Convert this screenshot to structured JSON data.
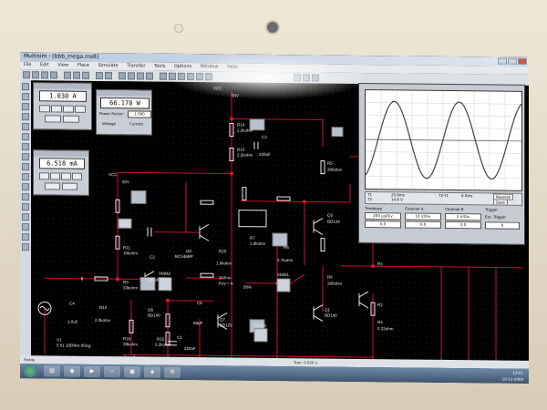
{
  "window": {
    "title": "Multisim - [bbb_mega.ms8]"
  },
  "menu": [
    "File",
    "Edit",
    "View",
    "Place",
    "Simulate",
    "Transfer",
    "Tools",
    "Options",
    "Window",
    "Help"
  ],
  "toolbar": {
    "circuit_list": "In Use List"
  },
  "ammeter": {
    "value": "1.030 A"
  },
  "wattmeter": {
    "value": "66.178 W",
    "pf_label": "Power Factor:",
    "pf_value": "1.000",
    "voltage_label": "Voltage",
    "current_label": "Current"
  },
  "milliammeter": {
    "value": "6.518 mA"
  },
  "components": {
    "vcc_top": "VCC",
    "v_top": "50V",
    "vcc_left": "VCC",
    "v_left": "50V",
    "r14": "R14",
    "r14v": "2.2kohm",
    "r13": "R13",
    "r13v": "2.2kohm",
    "c3": "C3",
    "c3v": "220uF",
    "r5": "R5",
    "r5v": "390ohm",
    "q3": "Q3",
    "q3v": "BD139",
    "q4": "Q4",
    "q4v": "MJE",
    "r1": "R1",
    "r11": "R11",
    "r11v": "10kohm",
    "c2": "C2",
    "c2v": "220uF",
    "q5": "Q5",
    "q5v": "BC546BP",
    "r20": "R20",
    "r20v": "1.8kohm",
    "r7": "R7",
    "r7v": "1.8kohm",
    "r8": "R8",
    "r8v": "4.7kohm",
    "pot": "2k0hm",
    "potkey": "Key = A",
    "pot_pct": "50%",
    "r6": "R6",
    "r6v": "390ohm",
    "r3": "R3",
    "r9": "R9",
    "r9v": "33kohm",
    "c4": "C4",
    "c4v": "1.0uF",
    "r10": "R10",
    "r10v": "2.0kohm",
    "q6": "Q6",
    "q6v": "BD140",
    "c6": "C6",
    "c6v": "68pF",
    "q7": "Q7",
    "q7v": "BD129",
    "q1": "Q1",
    "q1v": "BD140",
    "r4": "R4",
    "r4v": "0.33ohm",
    "r2": "R2",
    "r16": "R16",
    "r16v": "39kohm",
    "r15": "R15",
    "r15v": "2.2kohm",
    "c1": "C1",
    "c1v": "220uF",
    "r12": "R12",
    "r12v": "180ohm",
    "v1": "V1",
    "v1v": "0.61 1000Hz 0Deg",
    "xmm2": "XMM2",
    "xmm1": "XMM1",
    "xmm3": "XMM3"
  },
  "scope": {
    "t1": "T1",
    "t2": "T2",
    "t21": "T2-T1",
    "ch_a": "Channel A",
    "ch_b": "Channel B",
    "timebase": "Timebase",
    "trigger": "Trigger",
    "scale_t": "200 µs/Div",
    "scale_a": "10 V/Div",
    "scale_b": "5 V/Div",
    "xpos": "0.0",
    "ypos_a": "0.0",
    "ypos_b": "0.0",
    "reverse": "Reverse",
    "save": "Save",
    "ext_trig": "Ext. Trigger",
    "level": "0",
    "val1": "20.8ms",
    "val2": "14.6 V",
    "val3": "6.0ms"
  },
  "status": {
    "left": "Ready",
    "mid": "Tran: 0.020 s"
  },
  "clock": {
    "time": "13:01",
    "date": "10-12-2009"
  },
  "colors": {
    "wire": "#c8102e",
    "wire_node": "#e01030",
    "component": "#e8e8e8",
    "grid_dot": "#1a1a1a",
    "trace": "#444444"
  }
}
